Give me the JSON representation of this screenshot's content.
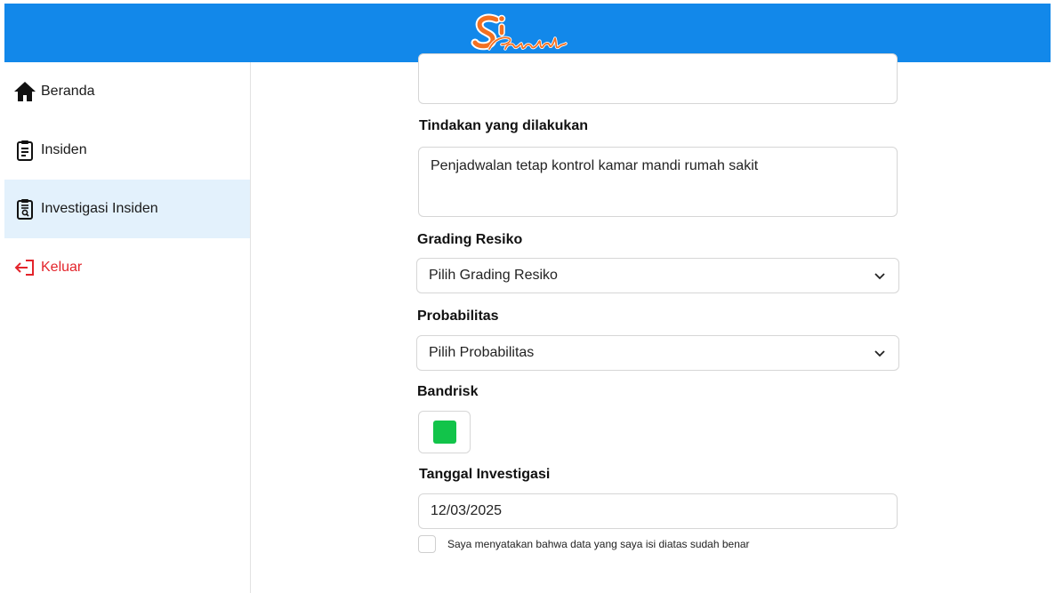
{
  "header": {
    "logo_text": "Si Pandir"
  },
  "sidebar": {
    "items": [
      {
        "label": "Beranda",
        "icon": "home-icon"
      },
      {
        "label": "Insiden",
        "icon": "clipboard-list-icon"
      },
      {
        "label": "Investigasi Insiden",
        "icon": "clipboard-search-icon",
        "active": true
      },
      {
        "label": "Keluar",
        "icon": "logout-icon",
        "color": "#e3242b"
      }
    ]
  },
  "form": {
    "previous_field_value": "",
    "tindakan": {
      "label": "Tindakan yang dilakukan",
      "value": "Penjadwalan tetap kontrol kamar mandi rumah sakit"
    },
    "grading": {
      "label": "Grading Resiko",
      "selected": "Pilih Grading Resiko"
    },
    "probabilitas": {
      "label": "Probabilitas",
      "selected": "Pilih Probabilitas"
    },
    "bandrisk": {
      "label": "Bandrisk",
      "color": "#12c44a"
    },
    "tanggal": {
      "label": "Tanggal Investigasi",
      "value": "12/03/2025"
    },
    "confirm": {
      "label": "Saya menyatakan bahwa data yang saya isi diatas sudah benar",
      "checked": false
    }
  },
  "colors": {
    "header": "#1288ea",
    "active_nav": "#e3f1fc",
    "logout": "#e3242b",
    "logo_orange": "#f37021"
  }
}
